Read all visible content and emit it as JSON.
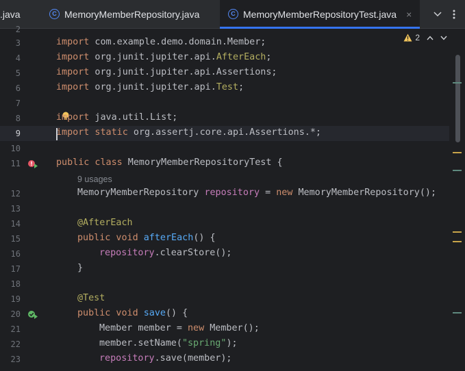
{
  "tabs": [
    {
      "label": ".java",
      "active": false
    },
    {
      "label": "MemoryMemberRepository.java",
      "active": false,
      "icon": "class-icon"
    },
    {
      "label": "MemoryMemberRepositoryTest.java",
      "active": true,
      "icon": "class-icon",
      "close": "×"
    }
  ],
  "inspections": {
    "warnings": "2"
  },
  "usage_hint": "9 usages",
  "line_numbers": [
    "2",
    "3",
    "4",
    "5",
    "6",
    "7",
    "8",
    "9",
    "10",
    "11",
    "",
    "12",
    "13",
    "14",
    "15",
    "16",
    "17",
    "18",
    "19",
    "20",
    "21",
    "22",
    "23"
  ],
  "code": {
    "l3": {
      "kw": "import",
      "rest": " com.example.demo.domain.Member;"
    },
    "l4": {
      "kw": "import",
      "pkg": " org.junit.jupiter.api.",
      "cls": "AfterEach",
      "end": ";"
    },
    "l5": {
      "kw": "import",
      "rest": " org.junit.jupiter.api.Assertions;"
    },
    "l6": {
      "kw": "import",
      "pkg": " org.junit.jupiter.api.",
      "cls": "Test",
      "end": ";"
    },
    "l8": {
      "kw": "import",
      "rest": " java.util.List;"
    },
    "l9": {
      "kw": "import",
      "kw2": " static",
      "rest": " org.assertj.core.api.Assertions.*;"
    },
    "l11": {
      "kw": "public class",
      "rest": " MemoryMemberRepositoryTest {"
    },
    "l12": {
      "type": "MemoryMemberRepository ",
      "field": "repository",
      "mid": " = ",
      "kw": "new",
      "rest": " MemoryMemberRepository();"
    },
    "l14": {
      "ann": "@AfterEach"
    },
    "l15": {
      "kw": "public void",
      "fn": " afterEach",
      "rest": "() {"
    },
    "l16": {
      "field": "repository",
      "rest": ".clearStore();"
    },
    "l17": {
      "rest": "}"
    },
    "l19": {
      "ann": "@Test"
    },
    "l20": {
      "kw": "public void",
      "fn": " save",
      "rest": "() {"
    },
    "l21": {
      "pre": "Member member = ",
      "kw": "new",
      "rest": " Member();"
    },
    "l22": {
      "pre": "member.setName(",
      "str": "\"spring\"",
      "rest": ");"
    },
    "l23": {
      "field": "repository",
      "rest": ".save(member);"
    }
  },
  "colors": {
    "background": "#1e1f22",
    "keyword": "#cf8e6d",
    "field": "#c77dbb",
    "function": "#57aaf7",
    "annotation": "#b3ae60",
    "string": "#6aab73",
    "accent": "#3574f0"
  }
}
